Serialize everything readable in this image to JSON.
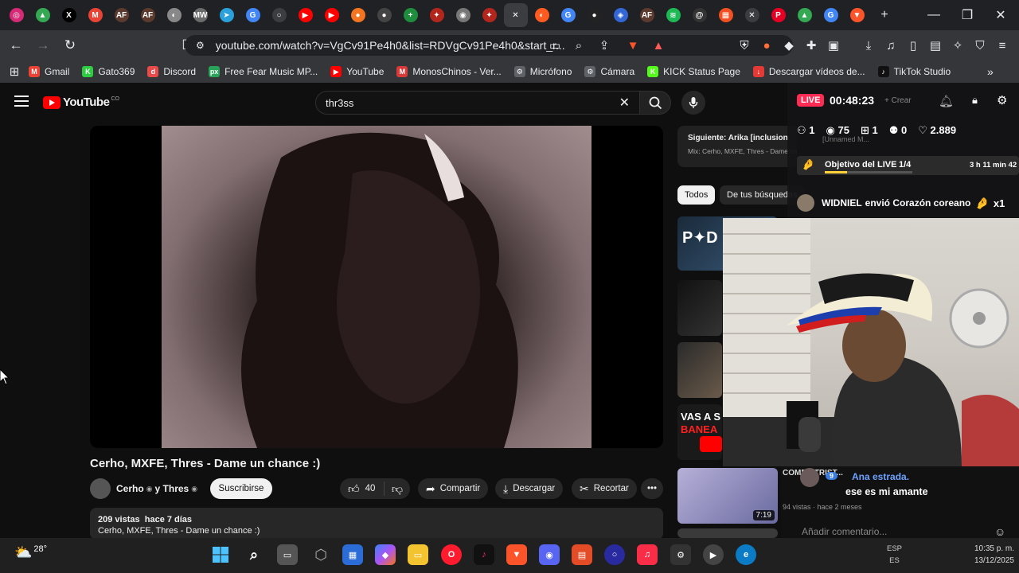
{
  "browser": {
    "tabs": [
      {
        "name": "instagram-tab",
        "color": "#d62976",
        "glyph": "◎"
      },
      {
        "name": "drive-tab",
        "color": "#34a853",
        "glyph": "▲"
      },
      {
        "name": "x-tab",
        "color": "#000000",
        "glyph": "X"
      },
      {
        "name": "gmail-tab",
        "color": "#ea4335",
        "glyph": "M"
      },
      {
        "name": "af-tab",
        "color": "#5c3b2e",
        "glyph": "AF"
      },
      {
        "name": "af-tab-2",
        "color": "#5c3b2e",
        "glyph": "AF"
      },
      {
        "name": "chrome-tab",
        "color": "#888888",
        "glyph": "◐"
      },
      {
        "name": "mw-tab",
        "color": "#6b6b6b",
        "glyph": "MW"
      },
      {
        "name": "telegram-tab",
        "color": "#2aa1da",
        "glyph": "➤"
      },
      {
        "name": "google-tab",
        "color": "#4285f4",
        "glyph": "G"
      },
      {
        "name": "loading-tab",
        "color": "#3c3d41",
        "glyph": "○"
      },
      {
        "name": "youtube-tab",
        "color": "#ff0000",
        "glyph": "▶"
      },
      {
        "name": "youtube-tab-2",
        "color": "#ff0000",
        "glyph": "▶"
      },
      {
        "name": "crunchy-tab",
        "color": "#f47521",
        "glyph": "●"
      },
      {
        "name": "github-tab",
        "color": "#444444",
        "glyph": "●"
      },
      {
        "name": "plus-tab",
        "color": "#1e8e3e",
        "glyph": "+"
      },
      {
        "name": "red-tab",
        "color": "#b3261e",
        "glyph": "✦"
      },
      {
        "name": "grey-tab",
        "color": "#777777",
        "glyph": "◉"
      },
      {
        "name": "red-tab-2",
        "color": "#b3261e",
        "glyph": "✦"
      },
      {
        "name": "active-tab",
        "color": "#3c3d41",
        "glyph": "✕"
      },
      {
        "name": "orange-tab",
        "color": "#ff5a1f",
        "glyph": "◐"
      },
      {
        "name": "google-tab-2",
        "color": "#4285f4",
        "glyph": "G"
      },
      {
        "name": "github-tab-2",
        "color": "#222222",
        "glyph": "●"
      },
      {
        "name": "blue-tab",
        "color": "#3367d6",
        "glyph": "◈"
      },
      {
        "name": "af-tab-3",
        "color": "#5c3b2e",
        "glyph": "AF"
      },
      {
        "name": "spotify-tab",
        "color": "#1db954",
        "glyph": "≋"
      },
      {
        "name": "threads-tab",
        "color": "#333333",
        "glyph": "@"
      },
      {
        "name": "microsoft-tab",
        "color": "#f25022",
        "glyph": "▦"
      },
      {
        "name": "mute-tab",
        "color": "#3c3d41",
        "glyph": "✕"
      },
      {
        "name": "pinterest-tab",
        "color": "#e60023",
        "glyph": "P"
      },
      {
        "name": "drive-tab-2",
        "color": "#34a853",
        "glyph": "▲"
      },
      {
        "name": "google-tab-3",
        "color": "#4285f4",
        "glyph": "G"
      },
      {
        "name": "brave-tab",
        "color": "#fb542b",
        "glyph": "▼"
      }
    ],
    "url": "youtube.com/watch?v=VgCv91Pe4h0&list=RDVgCv91Pe4h0&start_r...",
    "bookmarks": [
      {
        "label": "Gmail",
        "color": "#ea4335",
        "glyph": "M"
      },
      {
        "label": "Gato369",
        "color": "#2ecc40",
        "glyph": "K"
      },
      {
        "label": "Discord",
        "color": "#e84a4a",
        "glyph": "d"
      },
      {
        "label": "Free Fear Music MP...",
        "color": "#2aa35a",
        "glyph": "px"
      },
      {
        "label": "YouTube",
        "color": "#ff0000",
        "glyph": "▶"
      },
      {
        "label": "MonosChinos - Ver...",
        "color": "#d83a3a",
        "glyph": "M"
      },
      {
        "label": "Micrófono",
        "color": "#5f6368",
        "glyph": "⚙"
      },
      {
        "label": "Cámara",
        "color": "#5f6368",
        "glyph": "⚙"
      },
      {
        "label": "KICK Status Page",
        "color": "#53fc18",
        "glyph": "K"
      },
      {
        "label": "Descargar vídeos de...",
        "color": "#e53935",
        "glyph": "↓"
      },
      {
        "label": "TikTok Studio",
        "color": "#111111",
        "glyph": "♪"
      }
    ]
  },
  "youtube": {
    "logo_text": "YouTube",
    "logo_country": "CO",
    "search_value": "thr3ss",
    "video_title": "Cerho, MXFE, Thres - Dame un chance :)",
    "channel_names": "Cerho",
    "channel_sep": "y Thres",
    "subscribe_label": "Suscribirse",
    "likes": "40",
    "share_label": "Compartir",
    "download_label": "Descargar",
    "clip_label": "Recortar",
    "views": "209 vistas",
    "age": "hace 7 días",
    "description_line": "Cerho, MXFE, Thres - Dame un chance :)",
    "next_label": "Siguiente: Arika [inclusion",
    "next_mix": "Mix: Cerho, MXFE, Thres - Dame un chance :)",
    "chip_all": "Todos",
    "chip_search": "De tus búsquedas",
    "rec_duration": "7:19",
    "rec_text": "VAS A S",
    "rec_text_2": "BANEA",
    "rec_meta": "94 vistas · hace 2 meses",
    "rec_title_partial": "COMP... TRIST..."
  },
  "live": {
    "badge": "LIVE",
    "timer": "00:48:23",
    "create_label": "Crear",
    "stats": {
      "viewers_icon": "1",
      "views": "75",
      "gifts": "1",
      "followers": "0",
      "likes": "2.889"
    },
    "goal_label": "Objetivo del LIVE",
    "goal_progress": "1/4",
    "goal_fraction": 0.25,
    "goal_time": "3 h 11 min 42",
    "gift_user": "WIDNIEL",
    "gift_message": "envió Corazón coreano",
    "gift_count": "x1",
    "unnamed": "[Unnamed M..."
  },
  "chat": {
    "user": "Ana estrada.",
    "level": "9",
    "message": "ese es mi amante",
    "input_placeholder": "Añadir comentario..."
  },
  "taskbar": {
    "temperature": "28°",
    "lang": "ESP",
    "lang2": "ES",
    "time": "10:35 p. m.",
    "date": "13/12/2025"
  }
}
